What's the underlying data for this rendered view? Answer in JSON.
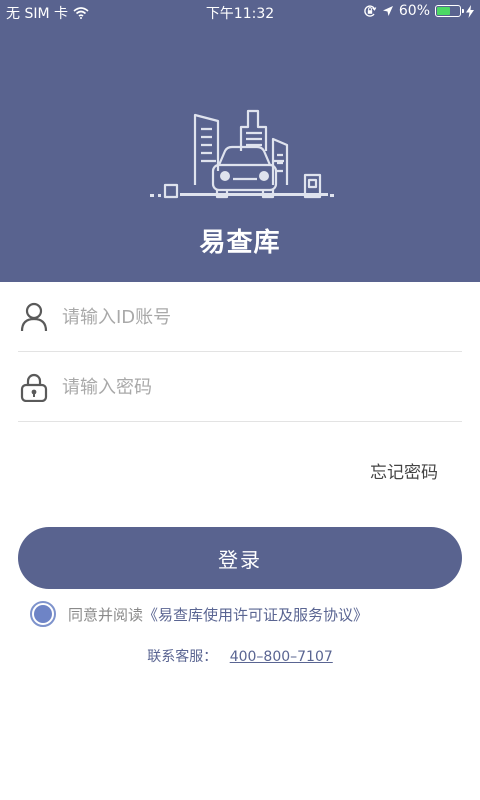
{
  "status_bar": {
    "carrier": "无 SIM 卡",
    "time": "下午11:32",
    "battery_percent": "60%",
    "battery_level": 0.6,
    "icons": [
      "wifi-icon",
      "orientation-lock-icon",
      "location-arrow-icon",
      "battery-icon",
      "charging-bolt-icon"
    ]
  },
  "header": {
    "background": "#59638f",
    "logo_icon": "city-car-icon",
    "app_name": "易查库"
  },
  "form": {
    "username": {
      "icon": "user-icon",
      "placeholder": "请输入ID账号",
      "value": ""
    },
    "password": {
      "icon": "lock-icon",
      "placeholder": "请输入密码",
      "value": ""
    },
    "forgot_label": "忘记密码",
    "login_label": "登录"
  },
  "agreement": {
    "checked": true,
    "prefix": "同意并阅读",
    "link": "《易查库使用许可证及服务协议》"
  },
  "contact": {
    "label": "联系客服：",
    "phone": "400–800–7107"
  },
  "colors": {
    "primary": "#59638f",
    "radio": "#6e84c6"
  }
}
